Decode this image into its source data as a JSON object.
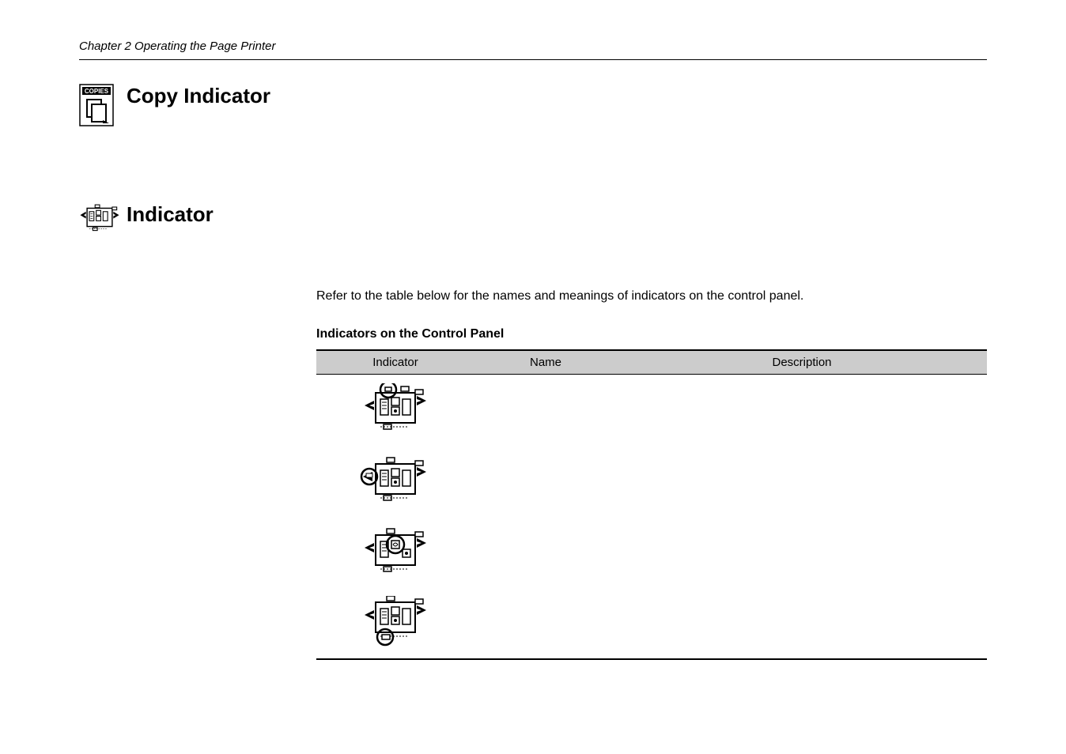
{
  "header": {
    "chapter_line": "Chapter 2  Operating the Page Printer"
  },
  "sections": {
    "copy_indicator": {
      "title": "Copy Indicator"
    },
    "indicator": {
      "title": "Indicator",
      "intro": "Refer to the table below for the names and meanings of indicators on the control panel.",
      "subtitle": "Indicators on the Control Panel"
    }
  },
  "table": {
    "columns": {
      "indicator": "Indicator",
      "name": "Name",
      "description": "Description"
    },
    "rows": [
      {
        "highlight": "top-left",
        "name": "",
        "description": ""
      },
      {
        "highlight": "left-tray",
        "name": "",
        "description": ""
      },
      {
        "highlight": "center-dial",
        "name": "",
        "description": ""
      },
      {
        "highlight": "bottom-tray",
        "name": "",
        "description": ""
      }
    ]
  },
  "icons": {
    "copies_label": "COPIES"
  }
}
